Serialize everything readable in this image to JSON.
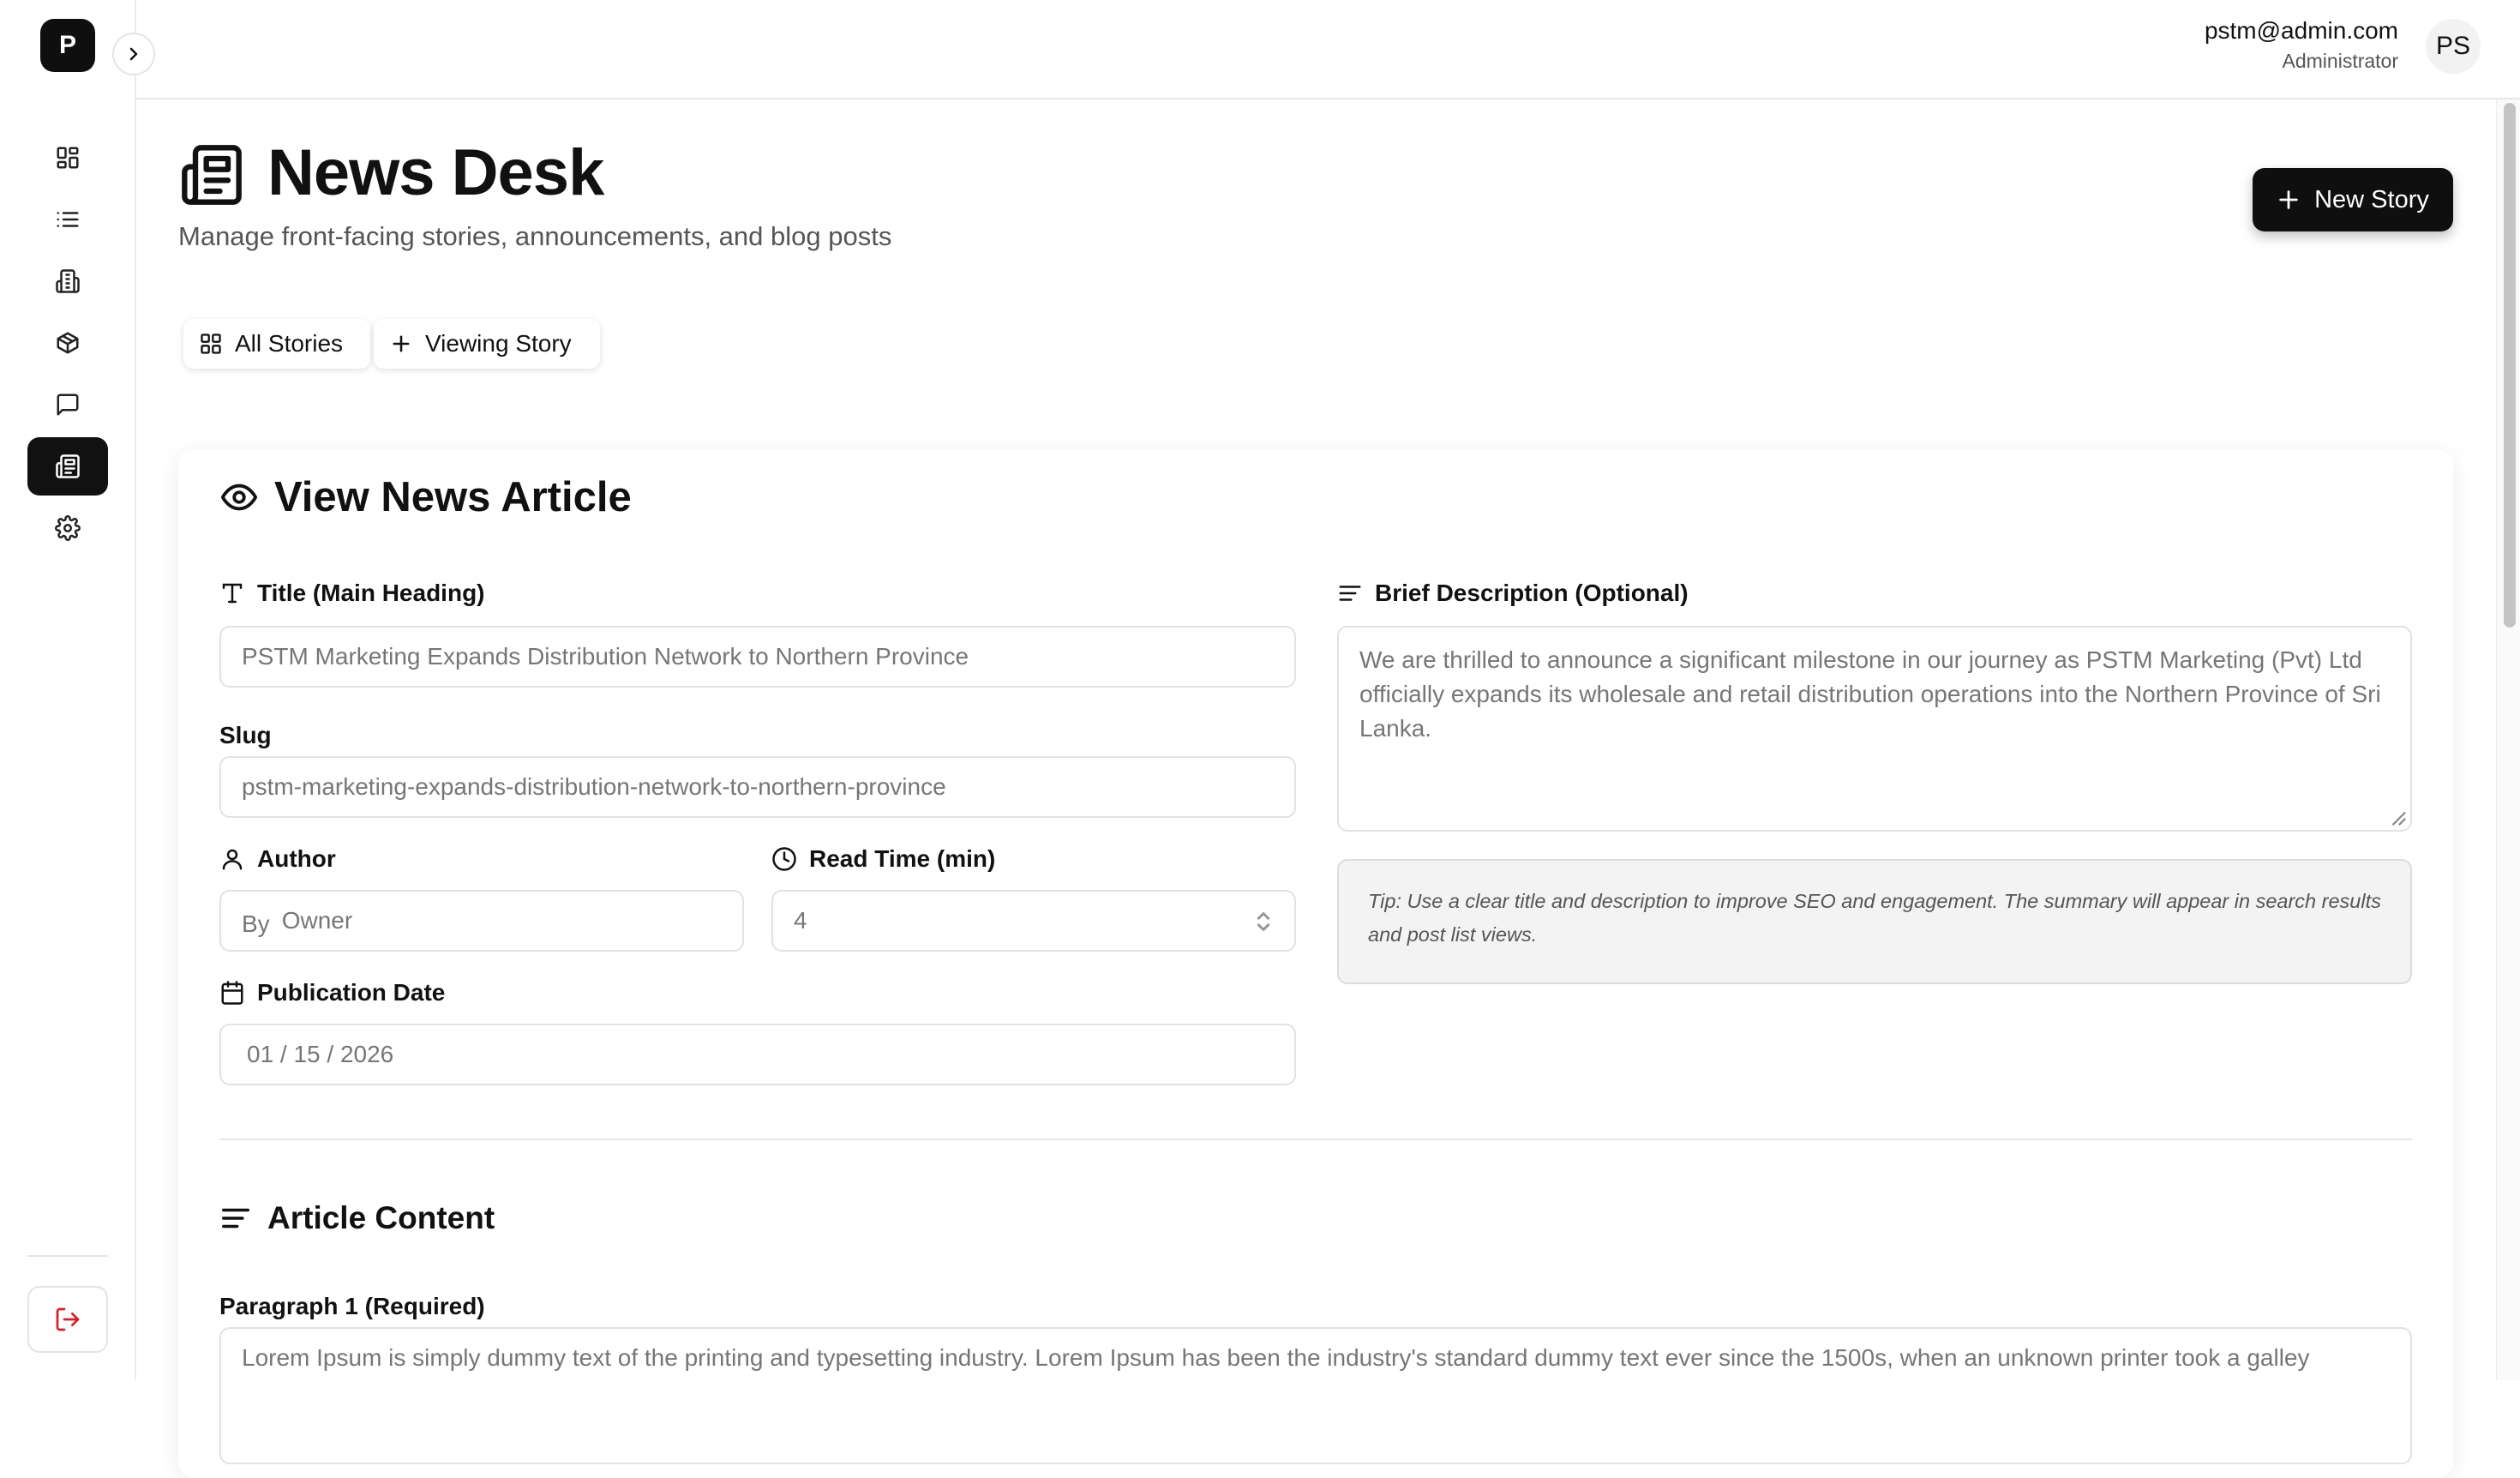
{
  "app": {
    "logo_letter": "P"
  },
  "user": {
    "email": "pstm@admin.com",
    "role": "Administrator",
    "initials": "PS"
  },
  "page": {
    "title": "News Desk",
    "subtitle": "Manage front-facing stories, announcements, and blog posts",
    "new_story_label": "New Story"
  },
  "tabs": [
    {
      "label": "All Stories",
      "icon": "grid-icon"
    },
    {
      "label": "Viewing Story",
      "icon": "plus-icon"
    }
  ],
  "sidebar": {
    "items": [
      {
        "name": "dashboard",
        "icon": "dashboard-icon",
        "active": false
      },
      {
        "name": "list",
        "icon": "list-icon",
        "active": false
      },
      {
        "name": "buildings",
        "icon": "building-icon",
        "active": false
      },
      {
        "name": "products",
        "icon": "package-icon",
        "active": false
      },
      {
        "name": "messages",
        "icon": "message-icon",
        "active": false
      },
      {
        "name": "news",
        "icon": "newspaper-icon",
        "active": true
      },
      {
        "name": "settings",
        "icon": "gear-icon",
        "active": false
      }
    ]
  },
  "form": {
    "card_title": "View News Article",
    "title_label": "Title (Main Heading)",
    "title_value": "PSTM Marketing Expands Distribution Network to Northern Province",
    "slug_label": "Slug",
    "slug_value": "pstm-marketing-expands-distribution-network-to-northern-province",
    "author_label": "Author",
    "author_prefix": "By",
    "author_value": "Owner",
    "read_time_label": "Read Time (min)",
    "read_time_value": "4",
    "pub_date_label": "Publication Date",
    "pub_date_value": "01 / 15 / 2026",
    "brief_label": "Brief Description (Optional)",
    "brief_value": "We are thrilled to announce a significant milestone in our journey as PSTM Marketing (Pvt) Ltd officially expands its wholesale and retail distribution operations into the Northern Province of Sri Lanka.",
    "tip": "Tip: Use a clear title and description to improve SEO and engagement. The summary will appear in search results and post list views.",
    "content_title": "Article Content",
    "paragraph1_label": "Paragraph 1 (Required)",
    "paragraph1_value": "Lorem Ipsum is simply dummy text of the printing and typesetting industry. Lorem Ipsum has been the industry's standard dummy text ever since the 1500s, when an unknown printer took a galley"
  },
  "colors": {
    "accent": "#0f0f0f",
    "logout": "#d41f2d",
    "muted_text": "#767676"
  }
}
